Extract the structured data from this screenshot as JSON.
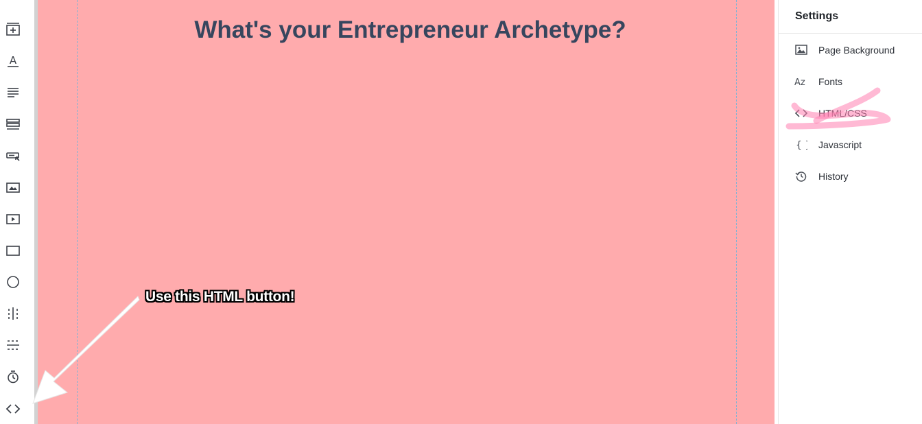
{
  "page": {
    "title": "What's your Entrepreneur Archetype?",
    "canvas_background": "#ffabad",
    "title_color": "#37465e"
  },
  "annotation": {
    "callout_text": "Use this HTML button!"
  },
  "toolbar": {
    "items": [
      {
        "name": "add-section-icon"
      },
      {
        "name": "text-icon"
      },
      {
        "name": "paragraph-icon"
      },
      {
        "name": "list-icon"
      },
      {
        "name": "button-icon"
      },
      {
        "name": "image-icon"
      },
      {
        "name": "video-icon"
      },
      {
        "name": "rectangle-icon"
      },
      {
        "name": "circle-icon"
      },
      {
        "name": "vertical-divider-icon"
      },
      {
        "name": "horizontal-divider-icon"
      },
      {
        "name": "timer-icon"
      },
      {
        "name": "code-icon"
      }
    ]
  },
  "settings": {
    "title": "Settings",
    "items": [
      {
        "label": "Page Background",
        "icon": "image-icon"
      },
      {
        "label": "Fonts",
        "icon": "fonts-icon"
      },
      {
        "label": "HTML/CSS",
        "icon": "code-icon"
      },
      {
        "label": "Javascript",
        "icon": "braces-icon"
      },
      {
        "label": "History",
        "icon": "history-icon"
      }
    ]
  }
}
